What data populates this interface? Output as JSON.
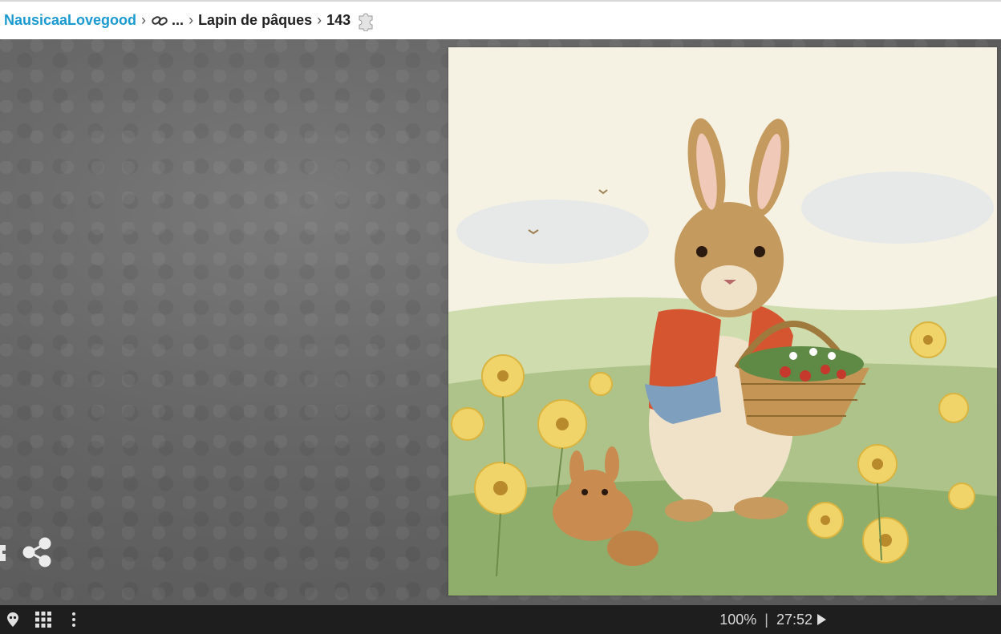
{
  "breadcrumb": {
    "user": "NausicaaLovegood",
    "ellipsis": "...",
    "album": "Lapin de pâques",
    "piece_count": "143"
  },
  "status": {
    "zoom": "100%",
    "separator": "|",
    "timer": "27:52"
  },
  "icons": {
    "link": "link-icon",
    "puzzle": "puzzle-piece-icon",
    "share": "share-icon",
    "edges": "edge-pieces-icon",
    "grid": "grid-icon",
    "menu": "more-vertical-icon"
  },
  "colors": {
    "accent": "#1b9ad1",
    "stage": "#666666",
    "bottombar": "#1e1e1e"
  }
}
